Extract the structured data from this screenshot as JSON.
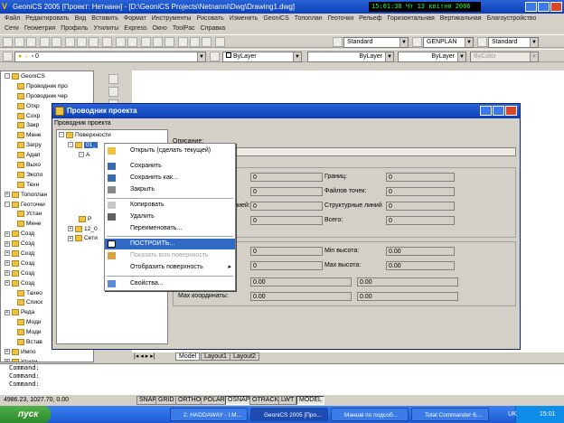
{
  "window": {
    "title": "GeoniCS 2005 [Проект: Нетнанн] - [D:\\GeoniCS Projects\\Netnanni\\Dwg\\Drawing1.dwg]",
    "clock": "15:01:38  Чт 13 квітня 2006"
  },
  "menu": [
    "Файл",
    "Редактировать",
    "Вид",
    "Вставить",
    "Формат",
    "Инструменты",
    "Рисовать",
    "Изменить",
    "GeoniCS",
    "Топоплан",
    "Геоточки",
    "Рельеф",
    "Горизонтальная",
    "Вертикальная",
    "Благоустройство"
  ],
  "menu2": [
    "Сети",
    "Геометрия",
    "Профиль",
    "Утилиты",
    "Express",
    "Окно",
    "ToolPac",
    "Справка"
  ],
  "toolbar": {
    "text_style": "Standard",
    "dim_style": "GENPLAN",
    "table_style": "Standard",
    "layer": "0",
    "color": "ByLayer",
    "linetype": "ByLayer",
    "lineweight": "ByLayer",
    "plotstyle": "ByColor"
  },
  "left_tree": [
    {
      "label": "GeoniCS",
      "exp": "-"
    },
    {
      "label": "Проводник про",
      "exp": ""
    },
    {
      "label": "Проводник чер",
      "exp": ""
    },
    {
      "label": "Откр",
      "exp": ""
    },
    {
      "label": "Сохр",
      "exp": ""
    },
    {
      "label": "Закр",
      "exp": ""
    },
    {
      "label": "Мене",
      "exp": ""
    },
    {
      "label": "Загру",
      "exp": ""
    },
    {
      "label": "Адап",
      "exp": ""
    },
    {
      "label": "Выхо",
      "exp": ""
    },
    {
      "label": "Экспо",
      "exp": ""
    },
    {
      "label": "Техн",
      "exp": ""
    },
    {
      "label": "Топоплан",
      "exp": "+"
    },
    {
      "label": "Геоточки",
      "exp": "-"
    },
    {
      "label": "Устан",
      "exp": ""
    },
    {
      "label": "Мене",
      "exp": ""
    },
    {
      "label": "Созд",
      "exp": "+"
    },
    {
      "label": "Созд",
      "exp": "+"
    },
    {
      "label": "Созд",
      "exp": "+"
    },
    {
      "label": "Созд",
      "exp": "+"
    },
    {
      "label": "Созд",
      "exp": "+"
    },
    {
      "label": "Созд",
      "exp": "+"
    },
    {
      "label": "Тахео",
      "exp": ""
    },
    {
      "label": "Списк",
      "exp": ""
    },
    {
      "label": "Реда",
      "exp": "+"
    },
    {
      "label": "Моди",
      "exp": ""
    },
    {
      "label": "Моди",
      "exp": ""
    },
    {
      "label": "Встав",
      "exp": ""
    },
    {
      "label": "Импо",
      "exp": "+"
    },
    {
      "label": "Утили",
      "exp": "+"
    }
  ],
  "dialog": {
    "title": "Проводник проекта",
    "subtitle": "Проводник проекта",
    "tree": {
      "root": "Поверхности",
      "selected": "01_",
      "child": "А",
      "node2": "12_0",
      "node3": "Сети",
      "node_p": "Р"
    },
    "description_label": "Описание:",
    "description_value": "т.",
    "fields": {
      "v1": "0",
      "v2": "0",
      "v3": "0",
      "v4": "0",
      "borders_label": "Границ:",
      "borders": "0",
      "points_label": "Файлов точек:",
      "points": "0",
      "struct_label": "Структурные линий",
      "struct": "0",
      "total_label": "Всего:",
      "total": "0",
      "lines_label": "лией:",
      "min_h_label": "Min высота:",
      "min_h": "0.00",
      "max_h_label": "Max высота:",
      "max_h": "0.00",
      "v5": "0",
      "v6": "0",
      "c1": "0.00",
      "c2": "0.00",
      "max_coord_label": "Max координаты:",
      "c3": "0.00",
      "c4": "0.00"
    }
  },
  "context_menu": {
    "open": "Открыть (сделать текущей)",
    "save": "Сохранить",
    "save_as": "Сохранить как...",
    "close": "Закрыть",
    "copy": "Копировать",
    "delete": "Удалить",
    "rename": "Переименовать...",
    "build": "ПОСТРОИТЬ...",
    "show_all": "Показать всю поверхность",
    "display": "Отобразить поверхность",
    "properties": "Свойства..."
  },
  "layout_tabs": [
    "Model",
    "Layout1",
    "Layout2"
  ],
  "command_lines": [
    "Command:",
    "Command:",
    "Command:"
  ],
  "status": {
    "coords": "4986.23, 1027.70, 0.00",
    "buttons": [
      "SNAP",
      "GRID",
      "ORTHO",
      "POLAR",
      "OSNAP",
      "OTRACK",
      "LWT",
      "MODEL"
    ]
  },
  "taskbar": {
    "start": "пуск",
    "tasks": [
      "2. HADDAWAY - I M...",
      "GeoniCS 2005 [Про...",
      "Манual по подсоб...",
      "Total Commander 6...."
    ],
    "lang": "UK",
    "time": "15:01"
  }
}
